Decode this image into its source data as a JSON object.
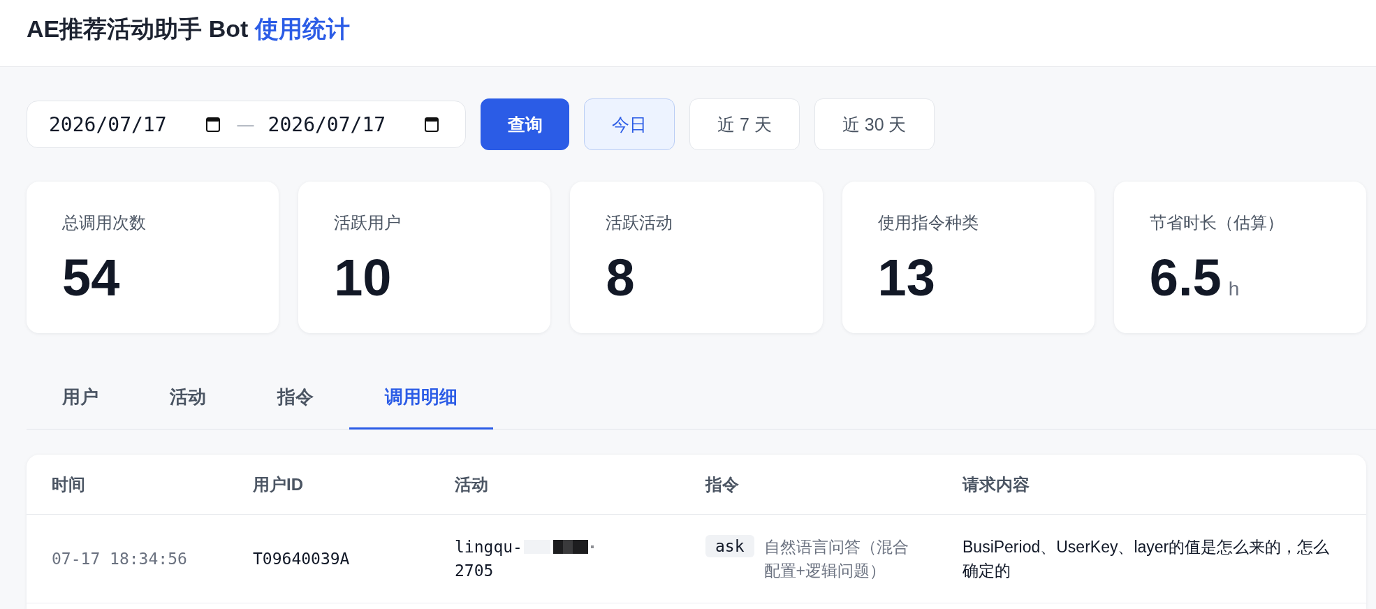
{
  "header": {
    "title": "AE推荐活动助手 Bot",
    "title_highlight": "使用统计"
  },
  "filters": {
    "date_from": "2026/07/17",
    "separator": "—",
    "date_to": "2026/07/17",
    "query_button": "查询",
    "presets": [
      {
        "label": "今日",
        "selected": true
      },
      {
        "label": "近 7 天",
        "selected": false
      },
      {
        "label": "近 30 天",
        "selected": false
      }
    ]
  },
  "stats": [
    {
      "label": "总调用次数",
      "value": "54"
    },
    {
      "label": "活跃用户",
      "value": "10"
    },
    {
      "label": "活跃活动",
      "value": "8"
    },
    {
      "label": "使用指令种类",
      "value": "13"
    },
    {
      "label": "节省时长（估算）",
      "value": "6.5",
      "unit": "h"
    }
  ],
  "tabs": [
    {
      "label": "用户",
      "selected": false
    },
    {
      "label": "活动",
      "selected": false
    },
    {
      "label": "指令",
      "selected": false
    },
    {
      "label": "调用明细",
      "selected": true
    }
  ],
  "table": {
    "columns": [
      "时间",
      "用户ID",
      "活动",
      "指令",
      "请求内容"
    ],
    "rows": [
      {
        "time": "07-17 18:34:56",
        "user_id": "T09640039A",
        "activity": {
          "prefix": "lingqu-",
          "suffix": "2705",
          "redacted": true
        },
        "command": {
          "code": "ask",
          "description": "自然语言问答（混合配置+逻辑问题）"
        },
        "request": "BusiPeriod、UserKey、layer的值是怎么来的，怎么确定的"
      }
    ]
  }
}
